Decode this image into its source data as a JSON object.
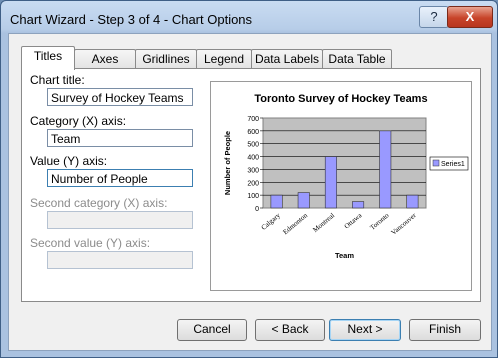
{
  "window": {
    "title": "Chart Wizard - Step 3 of 4 - Chart Options",
    "help_btn": "?",
    "close_btn": "X"
  },
  "tabs": [
    "Titles",
    "Axes",
    "Gridlines",
    "Legend",
    "Data Labels",
    "Data Table"
  ],
  "fields": {
    "chart_title_label": "Chart title:",
    "chart_title_value": "Survey of Hockey Teams",
    "category_x_label": "Category (X) axis:",
    "category_x_value": "Team",
    "value_y_label": "Value (Y) axis:",
    "value_y_value": "Number of People",
    "second_category_label": "Second category (X) axis:",
    "second_value_label": "Second value (Y) axis:"
  },
  "chart_data": {
    "type": "bar",
    "title": "Toronto Survey of Hockey Teams",
    "xlabel": "Team",
    "ylabel": "Number of People",
    "categories": [
      "Calgary",
      "Edmonton",
      "Montreal",
      "Ottawa",
      "Toronto",
      "Vancouver"
    ],
    "series": [
      {
        "name": "Series1",
        "values": [
          100,
          120,
          400,
          50,
          600,
          100
        ]
      }
    ],
    "ylim": [
      0,
      700
    ],
    "yticks": [
      "0",
      "100",
      "200",
      "300",
      "400",
      "500",
      "600",
      "700"
    ],
    "grid": true,
    "legend_position": "right",
    "bar_color": "#9999ff",
    "plot_bg": "#c0c0c0"
  },
  "buttons": {
    "cancel": "Cancel",
    "back": "< Back",
    "next": "Next >",
    "finish": "Finish"
  }
}
